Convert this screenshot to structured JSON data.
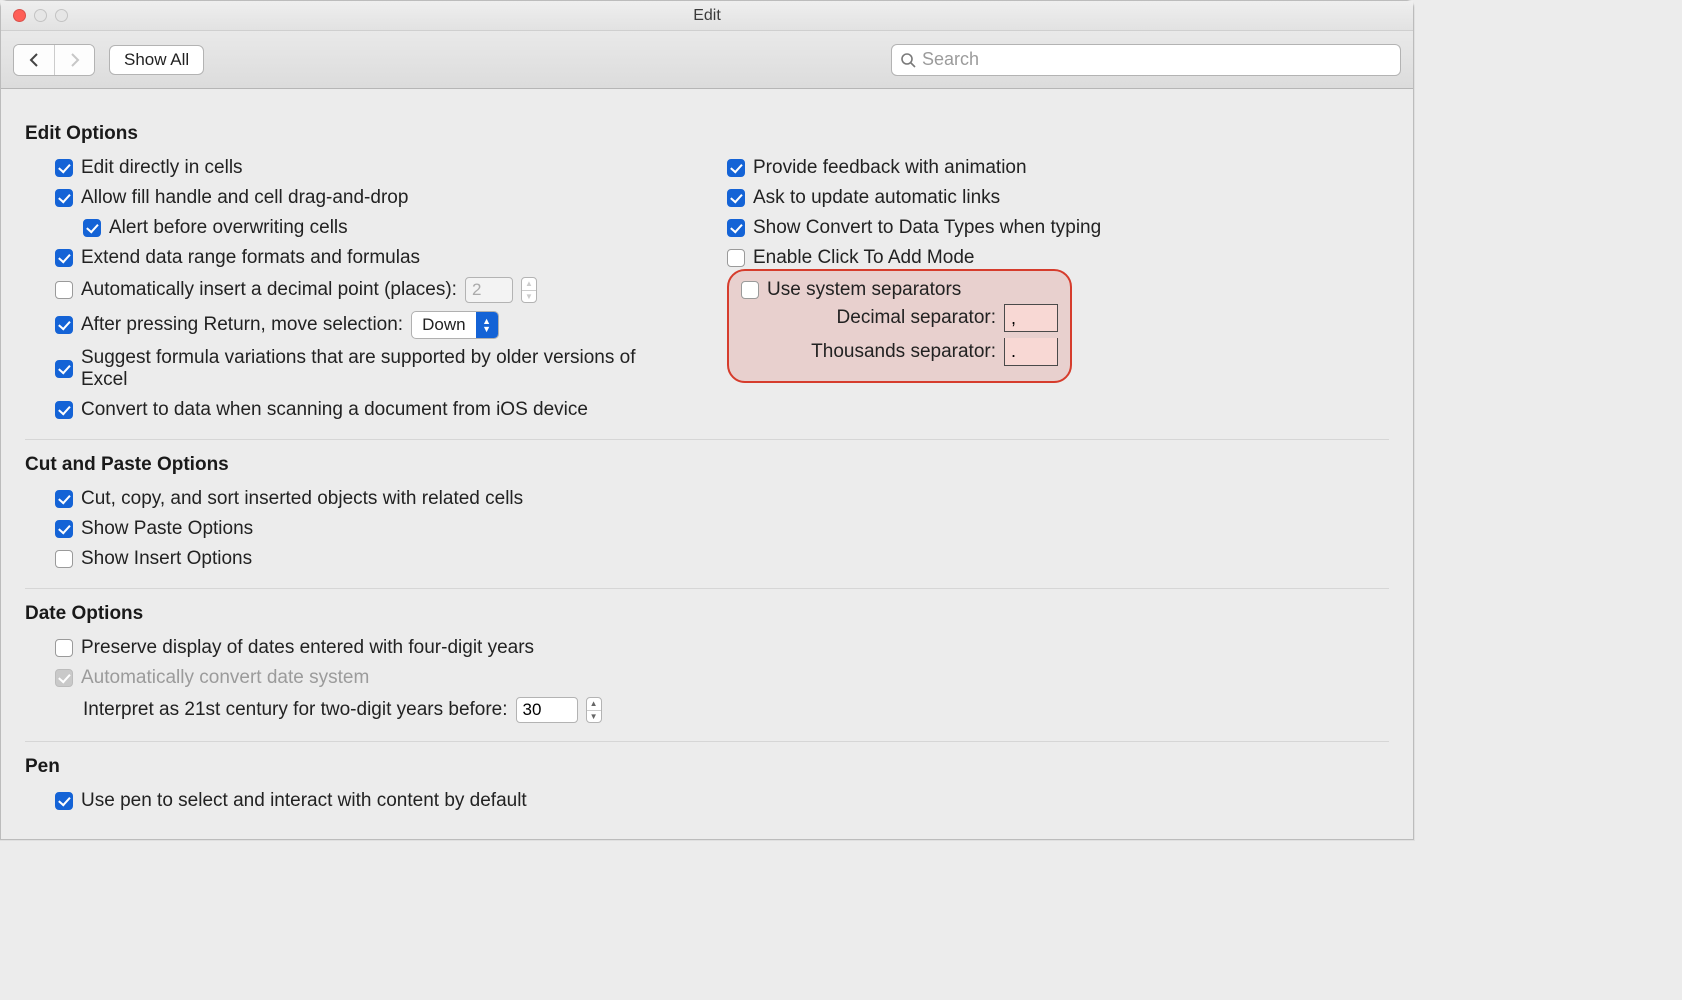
{
  "window": {
    "title": "Edit"
  },
  "toolbar": {
    "show_all": "Show All",
    "search_placeholder": "Search"
  },
  "sections": {
    "edit_options_title": "Edit Options",
    "cut_paste_title": "Cut and Paste Options",
    "date_options_title": "Date Options",
    "pen_title": "Pen"
  },
  "edit_left": {
    "edit_in_cells": "Edit directly in cells",
    "fill_handle": "Allow fill handle and cell drag-and-drop",
    "alert_overwrite": "Alert before overwriting cells",
    "extend_formats": "Extend data range formats and formulas",
    "auto_decimal_label": "Automatically insert a decimal point (places):",
    "auto_decimal_value": "2",
    "after_return_label": "After pressing Return, move selection:",
    "after_return_value": "Down",
    "suggest_variations": "Suggest formula variations that are supported by older versions of Excel",
    "convert_ios": "Convert to data when scanning a document from iOS device"
  },
  "edit_right": {
    "feedback_anim": "Provide feedback with animation",
    "ask_update_links": "Ask to update automatic links",
    "show_convert_types": "Show Convert to Data Types when typing",
    "click_to_add": "Enable Click To Add Mode",
    "use_system_sep": "Use system separators",
    "decimal_sep_label": "Decimal separator:",
    "decimal_sep_value": ",",
    "thousands_sep_label": "Thousands separator:",
    "thousands_sep_value": "."
  },
  "cut_paste": {
    "cut_copy_sort": "Cut, copy, and sort inserted objects with related cells",
    "show_paste": "Show Paste Options",
    "show_insert": "Show Insert Options"
  },
  "date": {
    "preserve_four_digit": "Preserve display of dates entered with four-digit years",
    "auto_convert": "Automatically convert date system",
    "interpret_label": "Interpret as 21st century for two-digit years before:",
    "interpret_value": "30"
  },
  "pen": {
    "use_pen": "Use pen to select and interact with content by default"
  }
}
